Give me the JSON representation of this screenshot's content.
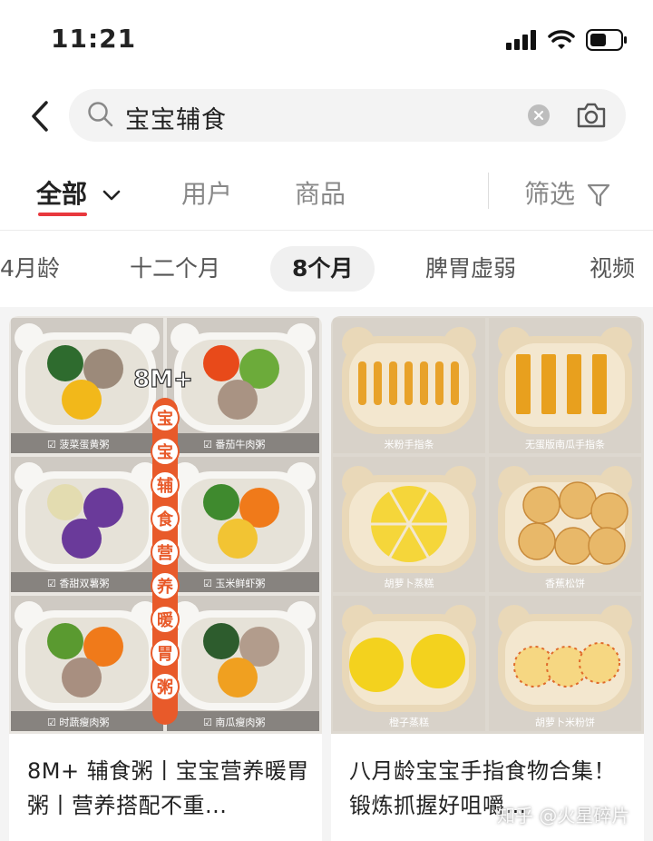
{
  "status_bar": {
    "time": "11:21"
  },
  "search": {
    "query": "宝宝辅食"
  },
  "tabs": [
    {
      "label": "全部"
    },
    {
      "label": "用户"
    },
    {
      "label": "商品"
    }
  ],
  "filter": {
    "label": "筛选"
  },
  "chips": [
    {
      "label": "4月龄"
    },
    {
      "label": "十二个月"
    },
    {
      "label": "8个月"
    },
    {
      "label": "脾胃虚弱"
    },
    {
      "label": "视频"
    }
  ],
  "cards": [
    {
      "title": "8M+ 辅食粥丨宝宝营养暖胃粥丨营养搭配不重...",
      "badge": "8M+",
      "banner_chars": [
        "宝",
        "宝",
        "辅",
        "食",
        "营",
        "养",
        "暖",
        "胃",
        "粥"
      ],
      "dishes": [
        "菠菜蛋黄粥",
        "番茄牛肉粥",
        "香甜双薯粥",
        "玉米鲜虾粥",
        "时蔬瘦肉粥",
        "南瓜瘦肉粥"
      ]
    },
    {
      "title": "八月龄宝宝手指食物合集！锻炼抓握好咀嚼...",
      "dishes": [
        "米粉手指条",
        "无蛋版南瓜手指条",
        "胡萝卜蒸糕",
        "香蕉松饼",
        "橙子蒸糕",
        "胡萝卜米粉饼"
      ]
    }
  ],
  "watermark": "知乎 @火星碎片",
  "colors": {
    "accent": "#e8383d",
    "banner": "#e85a2a"
  }
}
